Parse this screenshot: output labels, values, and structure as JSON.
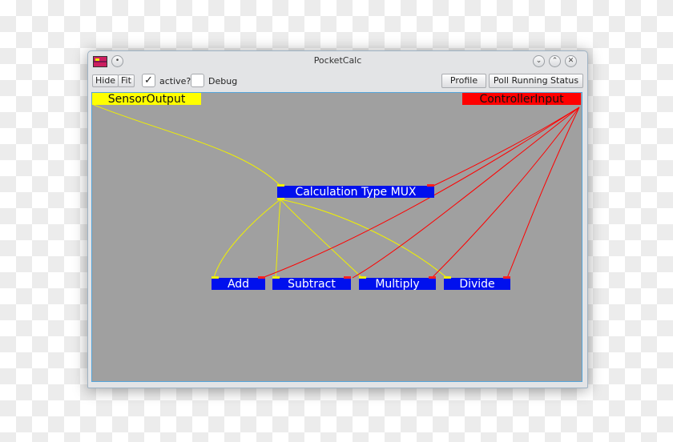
{
  "window": {
    "title": "PocketCalc",
    "min_glyph": "⌄",
    "max_glyph": "⌃",
    "close_glyph": "✕",
    "menu_glyph": "•"
  },
  "toolbar": {
    "hide_label": "Hide",
    "fit_label": "Fit",
    "active_label": "active?",
    "active_checked": true,
    "check_glyph": "✓",
    "debug_label": "Debug",
    "debug_checked": false,
    "profile_label": "Profile",
    "poll_label": "Poll Running Status"
  },
  "graph": {
    "sensor_output": "SensorOutput",
    "controller_input": "ControllerInput",
    "mux": "Calculation Type MUX",
    "add": "Add",
    "subtract": "Subtract",
    "multiply": "Multiply",
    "divide": "Divide"
  },
  "colors": {
    "canvas_bg": "#a0a0a0",
    "data_wire": "#f0f000",
    "control_wire": "#ff0000",
    "node_blue": "#0010ee"
  }
}
